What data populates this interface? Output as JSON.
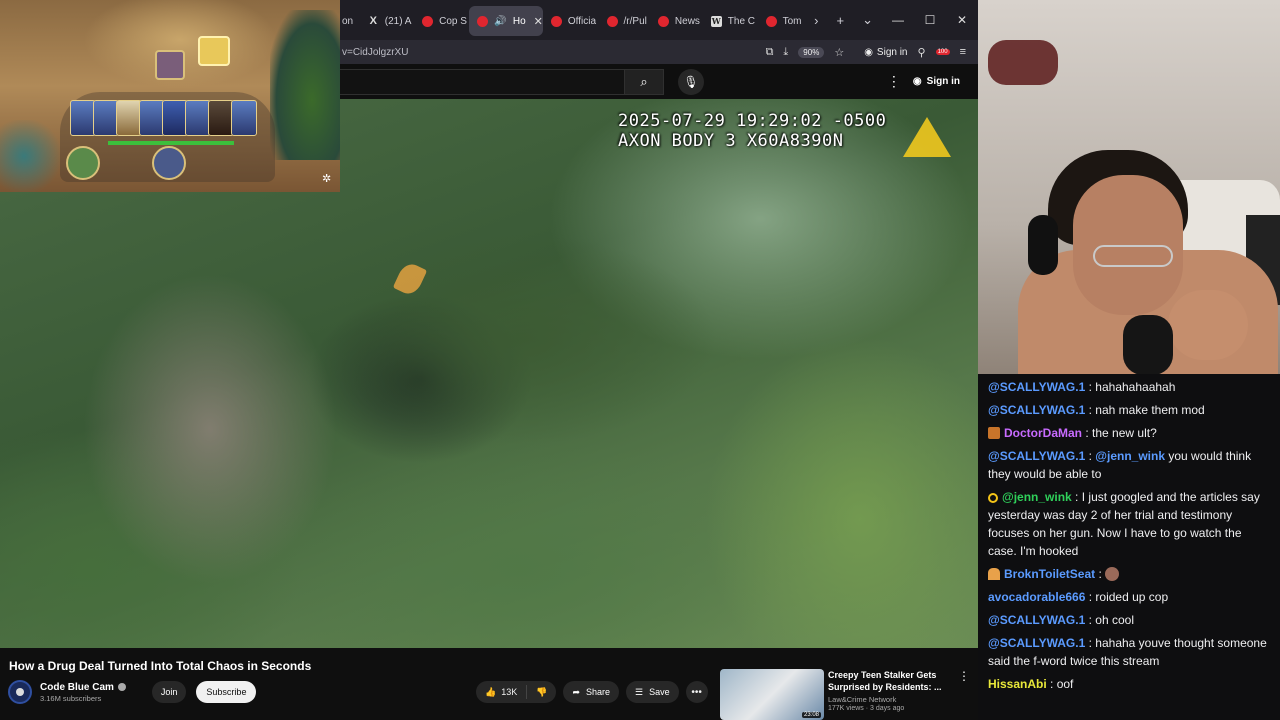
{
  "browser": {
    "tabs": [
      {
        "label": "on",
        "favicon": "red"
      },
      {
        "label": "(21) A",
        "favicon": "x"
      },
      {
        "label": "Cop S",
        "favicon": "red"
      },
      {
        "label": "Ho",
        "favicon": "red",
        "active": true
      },
      {
        "label": "Officia",
        "favicon": "red"
      },
      {
        "label": "/r/Pul",
        "favicon": "red"
      },
      {
        "label": "News",
        "favicon": "red"
      },
      {
        "label": "The C",
        "favicon": "w"
      },
      {
        "label": "Tom",
        "favicon": "red"
      }
    ],
    "url": "v=CidJolgzrXU",
    "zoom": "90%",
    "sign_in": "Sign in",
    "ext_badge": "100"
  },
  "youtube": {
    "sign_in": "Sign in",
    "video": {
      "overlay_line1": "2025-07-29 19:29:02 -0500",
      "overlay_line2": "AXON BODY 3 X60A8390N",
      "title": "How a Drug Deal Turned Into Total Chaos in Seconds"
    },
    "channel": {
      "name": "Code Blue Cam",
      "subscribers": "3.16M subscribers",
      "join_label": "Join",
      "subscribe_label": "Subscribe"
    },
    "actions": {
      "likes": "13K",
      "share_label": "Share",
      "save_label": "Save"
    },
    "recommended": {
      "title": "Creepy Teen Stalker Gets Surprised by Residents: ...",
      "channel": "Law&Crime Network",
      "meta": "177K views · 3 days ago",
      "duration": "23:08"
    }
  },
  "chat": [
    {
      "user": "@SCALLYWAG.1",
      "color": "#5b9bff",
      "badge": "",
      "text": "hahahahaahah",
      "emote": false
    },
    {
      "user": "@SCALLYWAG.1",
      "color": "#5b9bff",
      "badge": "",
      "text": "nah make them mod",
      "emote": false
    },
    {
      "user": "DoctorDaMan",
      "color": "#c86bff",
      "badge": "hat",
      "text": "the new ult?",
      "emote": false
    },
    {
      "user": "@SCALLYWAG.1",
      "color": "#5b9bff",
      "badge": "",
      "mention": "@jenn_wink",
      "text": "you would think they would be able to",
      "emote": false
    },
    {
      "user": "@jenn_wink",
      "color": "#2fd05a",
      "badge": "ring",
      "text": "I just googled and the articles say yesterday was day 2 of her trial and testimony focuses on her gun. Now I have to go watch the case. I'm hooked",
      "emote": false
    },
    {
      "user": "BroknToiletSeat",
      "color": "#5b9bff",
      "badge": "fig",
      "text": "",
      "emote": true
    },
    {
      "user": "avocadorable666",
      "color": "#5b9bff",
      "badge": "",
      "text": "roided up cop",
      "emote": false
    },
    {
      "user": "@SCALLYWAG.1",
      "color": "#5b9bff",
      "badge": "",
      "text": "oh cool",
      "emote": false
    },
    {
      "user": "@SCALLYWAG.1",
      "color": "#5b9bff",
      "badge": "",
      "text": "hahaha youve thought someone said the f-word twice this stream",
      "emote": false
    },
    {
      "user": "HissanAbi",
      "color": "#e8e83a",
      "badge": "",
      "text": "oof",
      "emote": false
    }
  ]
}
